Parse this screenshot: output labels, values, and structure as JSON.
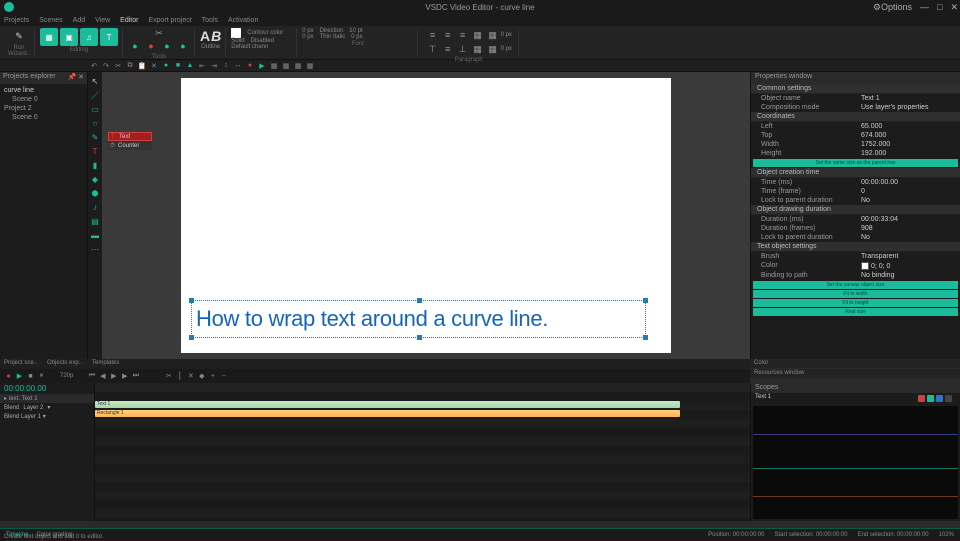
{
  "titlebar": {
    "title": "VSDC Video Editor - curve line"
  },
  "menu": [
    "Projects",
    "Scenes",
    "Add",
    "View",
    "Editor",
    "Export project",
    "Tools",
    "Activation"
  ],
  "ribbon": {
    "run": "Run\nWizard..",
    "add_object": "Add\nobject",
    "video_eff": "Video\neffects",
    "audio_eff": "Audio\neffects",
    "text": "Text",
    "editing": "Editing",
    "tools": "Tools",
    "cutsplit": "Cut and split",
    "outline": "Outline",
    "contour": "Contour color",
    "solid": "Solid",
    "disabled": "Disabled",
    "default": "Default chann",
    "direction": "Direction",
    "thinitalic": "Thin Italic",
    "px0": "0 px",
    "pt10": "10 pt",
    "font": "Font",
    "paragraph": "Paragraph"
  },
  "proj": {
    "title": "Projects explorer",
    "items": [
      "curve line",
      " Scene 0",
      "Project 2",
      " Scene 0"
    ]
  },
  "popup": {
    "text": "Text",
    "counter": "Counter"
  },
  "canvas_text": "How to wrap text around a curve line.",
  "props": {
    "title": "Properties window",
    "common": "Common settings",
    "object_name_k": "Object name",
    "object_name_v": "Text 1",
    "comp_mode_k": "Composition mode",
    "comp_mode_v": "Use layer's properties",
    "coords": "Coordinates",
    "left_k": "Left",
    "left_v": "65.000",
    "top_k": "Top",
    "top_v": "674.000",
    "width_k": "Width",
    "width_v": "1752.000",
    "height_k": "Height",
    "height_v": "192.000",
    "same_size": "Set the same size as the parent has",
    "creation": "Object creation time",
    "time_ms_k": "Time (ms)",
    "time_ms_v": "00:00:00.00",
    "time_frame_k": "Time (frame)",
    "time_frame_v": "0",
    "lock_parent_k": "Lock to parent duration",
    "lock_parent_v": "No",
    "drawing": "Object drawing duration",
    "dur_ms_k": "Duration (ms)",
    "dur_ms_v": "00:00:33:04",
    "dur_frames_k": "Duration (frames)",
    "dur_frames_v": "908",
    "lock_parent2_v": "No",
    "text_obj": "Text object settings",
    "brush_k": "Brush",
    "brush_v": "Transparent",
    "color_k": "Color",
    "color_v": "0; 0; 0",
    "binding_k": "Binding to path",
    "binding_v": "No binding",
    "bars": [
      "Set the canvas object size",
      "Fit to width",
      "Fit to height",
      "Real size"
    ]
  },
  "midtabs": [
    "Project sce..",
    "Objects exp..",
    "Templates"
  ],
  "tl": {
    "res": "720p",
    "timecode": "00:00:00.00",
    "sel": "▸ text: Text 1",
    "hdr": [
      "",
      "Blend",
      "Layer 2",
      "▾"
    ],
    "layers": [
      "Blend   Layer 1  ▾"
    ],
    "clip1": "Text 1",
    "clip2": "Rectangle 1"
  },
  "rightlower": {
    "color": "Color",
    "res": "Resources window",
    "scopes": "Scopes",
    "sel": "Text 1"
  },
  "status": {
    "tabs": [
      "Timeline",
      "Color grading"
    ],
    "hint": "Create text object and add it to editor.",
    "pos": "Position:  00:00:00:00",
    "start": "Start selection:  00:00:00:00",
    "end": "End selection:  00:00:00:00",
    "zoom": "102%"
  },
  "winctrl": {
    "opts": "⚙Options",
    "min": "—",
    "max": "□",
    "close": "✕"
  }
}
